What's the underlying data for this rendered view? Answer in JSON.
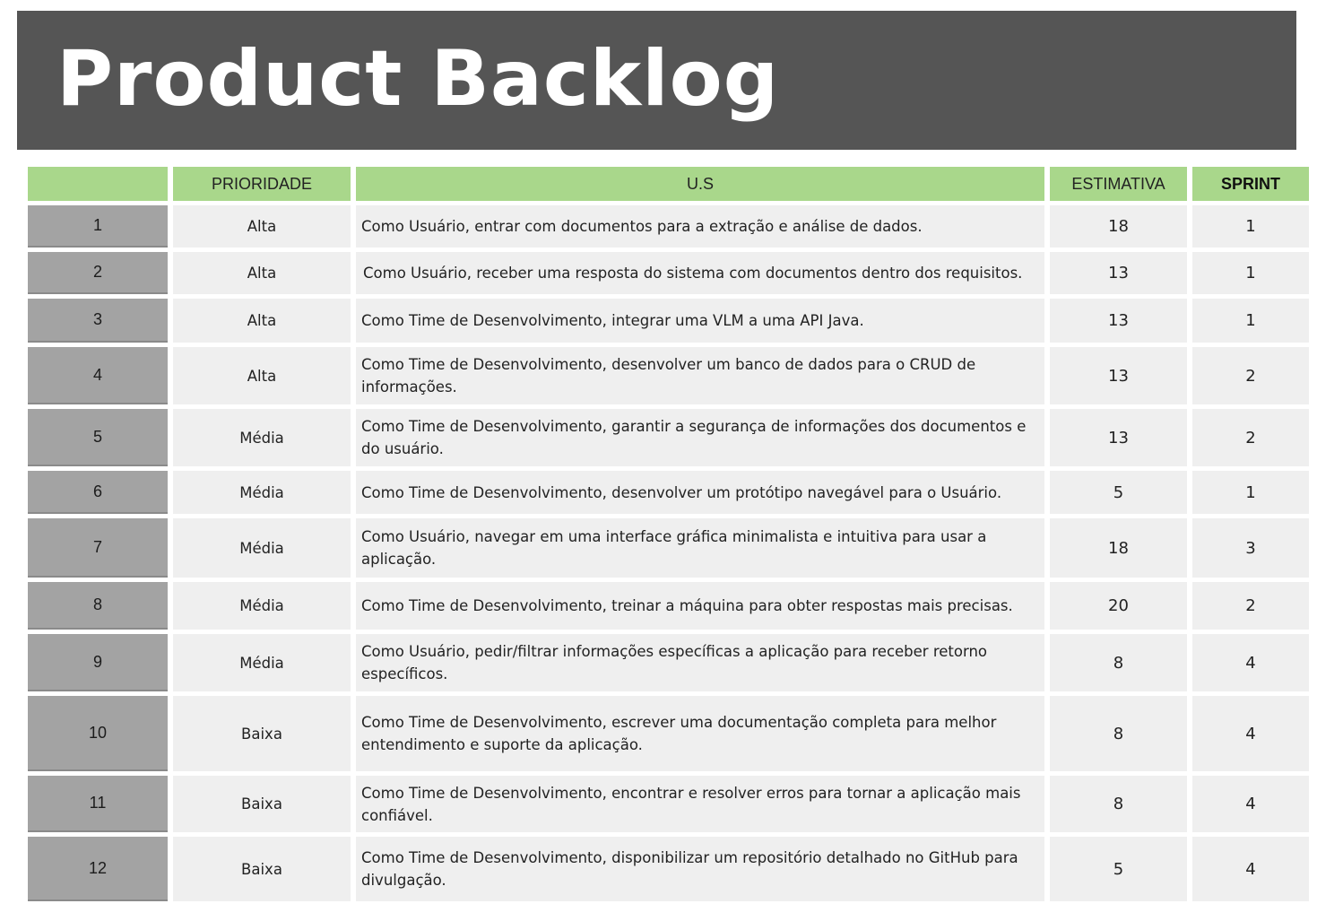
{
  "title": "Product Backlog",
  "header": {
    "id": "",
    "priority": "PRIORIDADE",
    "story": "U.S",
    "estimate": "ESTIMATIVA",
    "sprint": "SPRINT"
  },
  "rows": [
    {
      "id": "1",
      "priority": "Alta",
      "story": "Como Usuário, entrar com documentos para a extração e análise de dados.",
      "estimate": "18",
      "sprint": "1"
    },
    {
      "id": "2",
      "priority": "Alta",
      "story": "Como Usuário, receber uma resposta do sistema com documentos dentro dos requisitos.",
      "estimate": "13",
      "sprint": "1"
    },
    {
      "id": "3",
      "priority": "Alta",
      "story": "Como Time de Desenvolvimento, integrar uma VLM a uma API Java.",
      "estimate": "13",
      "sprint": "1"
    },
    {
      "id": "4",
      "priority": "Alta",
      "story": "Como Time de Desenvolvimento, desenvolver um banco de dados para o CRUD de informações.",
      "estimate": "13",
      "sprint": "2"
    },
    {
      "id": "5",
      "priority": "Média",
      "story": "Como Time de Desenvolvimento, garantir a segurança de informações dos documentos e do usuário.",
      "estimate": "13",
      "sprint": "2"
    },
    {
      "id": "6",
      "priority": "Média",
      "story": "Como Time de Desenvolvimento, desenvolver um protótipo navegável para o Usuário.",
      "estimate": "5",
      "sprint": "1"
    },
    {
      "id": "7",
      "priority": "Média",
      "story": "Como Usuário, navegar em uma interface gráfica minimalista e intuitiva para usar a aplicação.",
      "estimate": "18",
      "sprint": "3"
    },
    {
      "id": "8",
      "priority": "Média",
      "story": "Como Time de Desenvolvimento, treinar a máquina para obter respostas mais precisas.",
      "estimate": "20",
      "sprint": "2"
    },
    {
      "id": "9",
      "priority": "Média",
      "story": "Como Usuário, pedir/filtrar informações específicas a aplicação para receber retorno específicos.",
      "estimate": "8",
      "sprint": "4"
    },
    {
      "id": "10",
      "priority": "Baixa",
      "story": "Como Time de Desenvolvimento, escrever uma documentação completa para melhor entendimento e suporte da aplicação.",
      "estimate": "8",
      "sprint": "4"
    },
    {
      "id": "11",
      "priority": "Baixa",
      "story": "Como Time de Desenvolvimento, encontrar e resolver erros para tornar a aplicação mais confiável.",
      "estimate": "8",
      "sprint": "4"
    },
    {
      "id": "12",
      "priority": "Baixa",
      "story": "Como Time de Desenvolvimento, disponibilizar um repositório detalhado no GitHub para divulgação.",
      "estimate": "5",
      "sprint": "4"
    }
  ],
  "colors": {
    "banner": "#555555",
    "header_green": "#a9d78b",
    "id_gray": "#a3a3a3",
    "cell_light": "#efefef"
  }
}
